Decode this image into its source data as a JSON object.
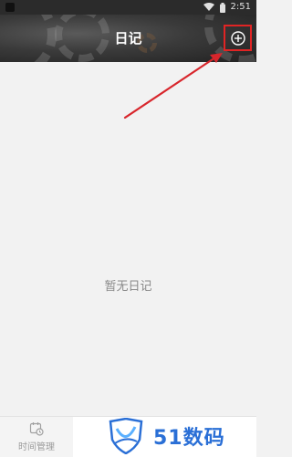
{
  "status_bar": {
    "time": "2:51",
    "icons": [
      "wifi-icon",
      "battery-icon"
    ]
  },
  "header": {
    "title": "日记",
    "add_button_icon": "plus-circle-icon"
  },
  "content": {
    "empty_text": "暂无日记"
  },
  "tabbar": {
    "tabs": [
      {
        "label": "时间管理",
        "icon": "calendar-clock-icon"
      }
    ]
  },
  "watermark": {
    "text": "51数码",
    "icon": "shield-logo-icon"
  },
  "colors": {
    "header_bg": "#3a3a3a",
    "highlight": "#e02424",
    "empty_text": "#8a8a8a",
    "watermark_blue": "#2a6fd6"
  }
}
